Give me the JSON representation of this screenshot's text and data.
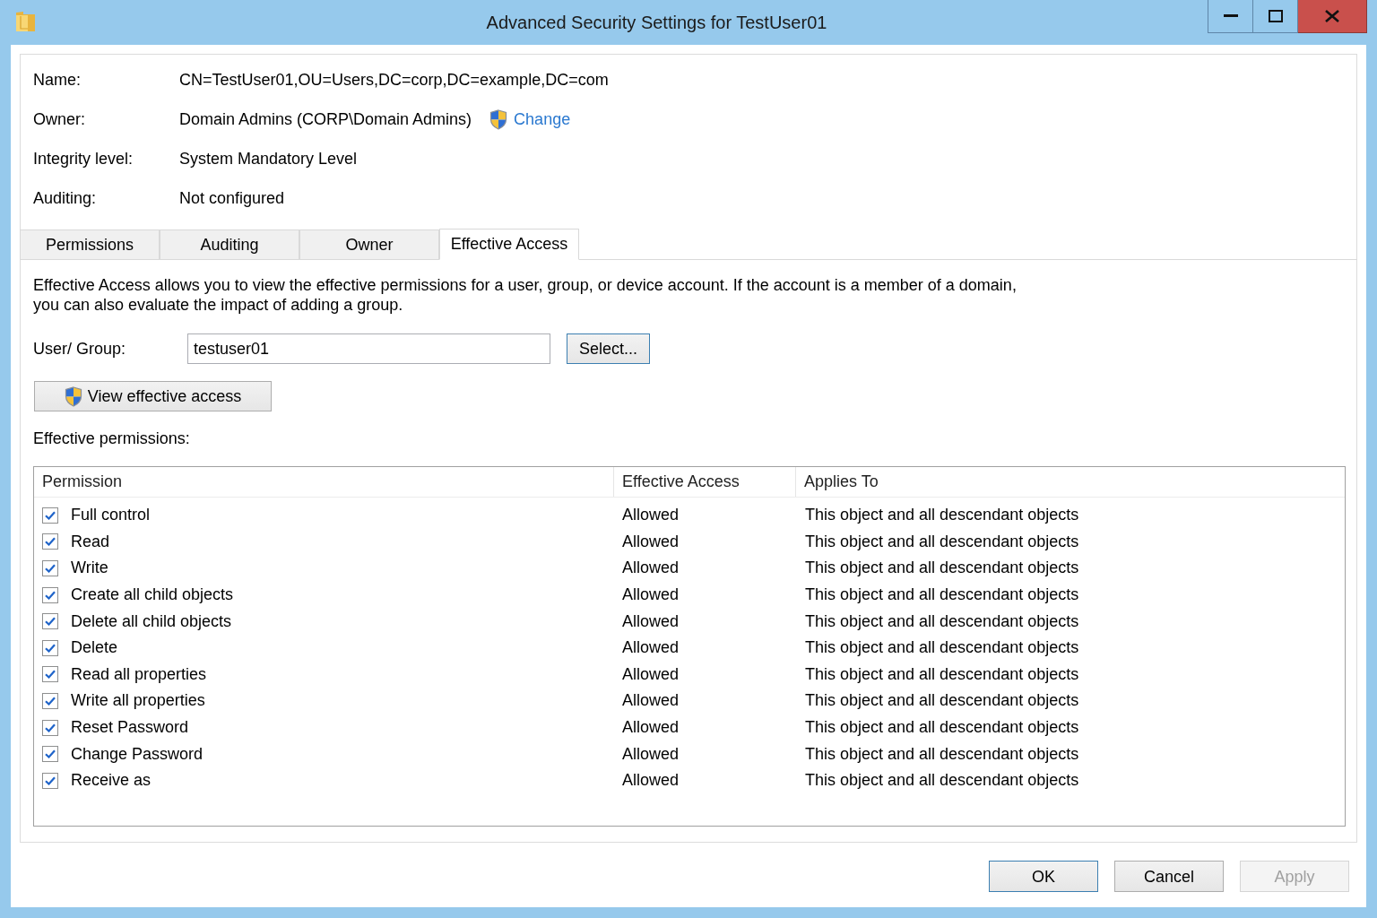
{
  "window": {
    "title": "Advanced Security Settings for TestUser01"
  },
  "details": [
    {
      "label": "Name:",
      "value": "CN=TestUser01,OU=Users,DC=corp,DC=example,DC=com"
    },
    {
      "label": "Owner:",
      "value": "Domain Admins (CORP\\Domain Admins)",
      "link": "Change"
    },
    {
      "label": "Integrity level:",
      "value": "System Mandatory Level"
    },
    {
      "label": "Auditing:",
      "value": "Not configured"
    }
  ],
  "tabs": [
    {
      "label": "Permissions",
      "selected": false
    },
    {
      "label": "Auditing",
      "selected": false
    },
    {
      "label": "Owner",
      "selected": false
    },
    {
      "label": "Effective Access",
      "selected": true
    }
  ],
  "effective_access": {
    "description_lines": [
      "Effective Access allows you to view the effective permissions for a user, group, or device account. If the account is a member of a domain,",
      "you can also evaluate the impact of adding a group."
    ],
    "user_group": {
      "label": "User/ Group:",
      "value": "testuser01"
    },
    "select_button": {
      "label": "Select...",
      "highlighted": true
    },
    "view_button": {
      "label": "View effective access",
      "highlighted": false
    },
    "permissions_label": "Effective permissions:",
    "table": {
      "columns": [
        "Permission",
        "Effective Access",
        "Applies To"
      ],
      "rows": [
        {
          "permission": "Full control",
          "checked": true,
          "effective_access": "Allowed",
          "applies_to": "This object and all descendant objects"
        },
        {
          "permission": "Read",
          "checked": true,
          "effective_access": "Allowed",
          "applies_to": "This object and all descendant objects"
        },
        {
          "permission": "Write",
          "checked": true,
          "effective_access": "Allowed",
          "applies_to": "This object and all descendant objects"
        },
        {
          "permission": "Create all child objects",
          "checked": true,
          "effective_access": "Allowed",
          "applies_to": "This object and all descendant objects"
        },
        {
          "permission": "Delete all child objects",
          "checked": true,
          "effective_access": "Allowed",
          "applies_to": "This object and all descendant objects"
        },
        {
          "permission": "Delete",
          "checked": true,
          "effective_access": "Allowed",
          "applies_to": "This object and all descendant objects"
        },
        {
          "permission": "Read all properties",
          "checked": true,
          "effective_access": "Allowed",
          "applies_to": "This object and all descendant objects"
        },
        {
          "permission": "Write all properties",
          "checked": true,
          "effective_access": "Allowed",
          "applies_to": "This object and all descendant objects"
        },
        {
          "permission": "Reset Password",
          "checked": true,
          "effective_access": "Allowed",
          "applies_to": "This object and all descendant objects"
        },
        {
          "permission": "Change Password",
          "checked": true,
          "effective_access": "Allowed",
          "applies_to": "This object and all descendant objects"
        },
        {
          "permission": "Receive as",
          "checked": true,
          "effective_access": "Allowed",
          "applies_to": "This object and all descendant objects"
        }
      ]
    }
  },
  "buttons": [
    {
      "label": "OK",
      "highlighted": true,
      "disabled": false
    },
    {
      "label": "Cancel",
      "highlighted": false,
      "disabled": false
    },
    {
      "label": "Apply",
      "highlighted": false,
      "disabled": true
    }
  ]
}
